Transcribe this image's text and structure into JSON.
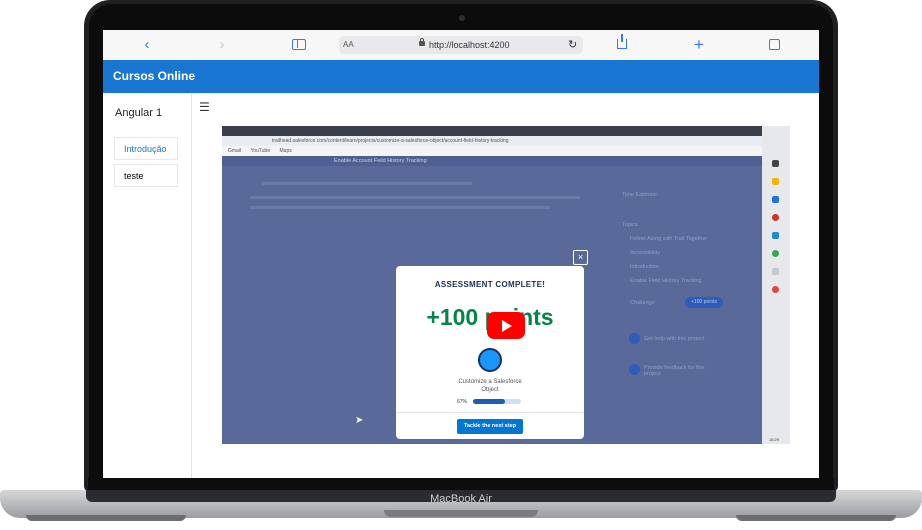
{
  "device": {
    "label": "MacBook Air"
  },
  "browser": {
    "reader_label": "AA",
    "url": "http://localhost:4200",
    "icons": [
      "chevron-left-icon",
      "chevron-right-icon",
      "book-icon",
      "lock-icon",
      "reload-icon",
      "share-icon",
      "plus-icon",
      "tabs-icon"
    ]
  },
  "app": {
    "title": "Cursos Online",
    "brand_color": "#1976d2",
    "course_title": "Angular 1",
    "lessons": [
      {
        "label": "Introdução",
        "active": true
      },
      {
        "label": "teste",
        "active": false
      }
    ]
  },
  "video": {
    "address": "trailhead.salesforce.com/content/learn/projects/customize-a-salesforce-object/account-field-history-tracking",
    "bookmarks": [
      "Gmail",
      "YouTube",
      "Maps"
    ],
    "page_heading": "Enable Account Field History Tracking",
    "topics_heading": "Topics",
    "time_estimate_label": "Time Estimate",
    "topics": [
      "Follow Along with Trail Together",
      "Accessibility",
      "Introduction",
      "Enable Field History Tracking"
    ],
    "challenge_label": "Challenge",
    "challenge_points": "+100 points",
    "help_link": "Get help with this project",
    "feedback_link": "Provide feedback for this project",
    "modal": {
      "title": "ASSESSMENT COMPLETE!",
      "points": "+100 points",
      "badge_label": "Customize a Salesforce Object",
      "progress_text": "67%",
      "progress": 0.67,
      "button": "Tackle the next step",
      "close": "×"
    },
    "taskbar_time": "15:29"
  }
}
